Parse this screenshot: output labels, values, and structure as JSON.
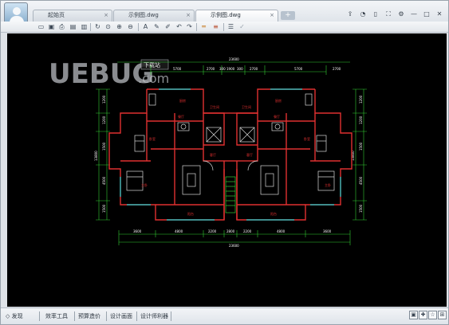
{
  "tabs": [
    {
      "label": "起始页",
      "close": "×"
    },
    {
      "label": "示例图.dwg",
      "close": "×"
    },
    {
      "label": "示例图.dwg",
      "close": "×"
    }
  ],
  "new_tab_label": "+",
  "window_controls": {
    "minimize": "—",
    "maximize": "□",
    "close": "✕"
  },
  "watermark": {
    "brand": "UEBUG",
    "suffix": ".com",
    "badge": "下载站"
  },
  "drawing": {
    "dim_top_total": "23600",
    "dim_top": [
      "5700",
      "2700",
      "300",
      "1900",
      "300",
      "2700",
      "5700",
      "2700"
    ],
    "dim_bottom": [
      "3600",
      "4800",
      "2200",
      "2800",
      "2200",
      "4800",
      "3600"
    ],
    "dim_bottom_total": "23600",
    "dim_left": [
      "1200",
      "1200",
      "1500",
      "4500",
      "1500",
      "13800"
    ],
    "dim_right": [
      "1200",
      "1200",
      "1500",
      "4500",
      "1500",
      "13800"
    ],
    "room_labels": [
      "厨房",
      "厨房",
      "餐厅",
      "餐厅",
      "卫生间",
      "卫生间",
      "客厅",
      "客厅",
      "卧室",
      "卧室",
      "主卧",
      "主卧",
      "阳台",
      "阳台"
    ]
  },
  "statusbar": {
    "items": [
      "发现",
      "效率工具",
      "预算造价",
      "设计画面",
      "设计师利器"
    ],
    "icon_bullet": "◇",
    "right_icons": [
      "▣",
      "✚",
      "☆",
      "⊞"
    ]
  },
  "colors": {
    "canvas_bg": "#000000",
    "wall": "#e03030",
    "dimension": "#ffffff",
    "dim_line": "#33cc33",
    "fixture": "#d9d9d9",
    "accent_cyan": "#22d3d3"
  }
}
